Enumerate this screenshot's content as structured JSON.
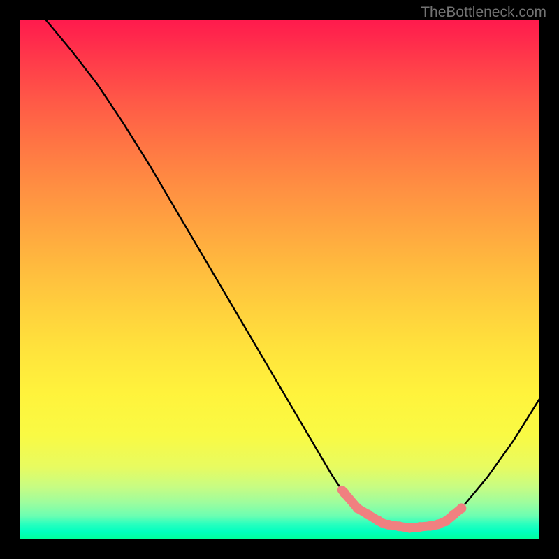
{
  "watermark": "TheBottleneck.com",
  "chart_data": {
    "type": "line",
    "title": "",
    "xlabel": "",
    "ylabel": "",
    "xlim": [
      0,
      100
    ],
    "ylim": [
      0,
      100
    ],
    "series": [
      {
        "name": "curve",
        "x": [
          5,
          10,
          15,
          20,
          25,
          30,
          35,
          40,
          45,
          50,
          55,
          60,
          62,
          65,
          70,
          75,
          80,
          82,
          85,
          90,
          95,
          100
        ],
        "values": [
          100,
          94,
          87.5,
          80,
          72,
          63.5,
          55,
          46.5,
          38,
          29.5,
          21,
          12.5,
          9.5,
          6,
          3,
          2.2,
          2.7,
          3.5,
          6,
          12,
          19,
          27
        ]
      }
    ],
    "highlight_region": {
      "x_start": 62,
      "x_end": 85
    },
    "highlight_dots_x": [
      62.5,
      65,
      67,
      69,
      71,
      73,
      75,
      77,
      79,
      80.5,
      82,
      83.5,
      85
    ],
    "gradient_colors": {
      "top": "#ff1a4d",
      "mid": "#ffe43c",
      "bottom": "#00ff99"
    }
  }
}
